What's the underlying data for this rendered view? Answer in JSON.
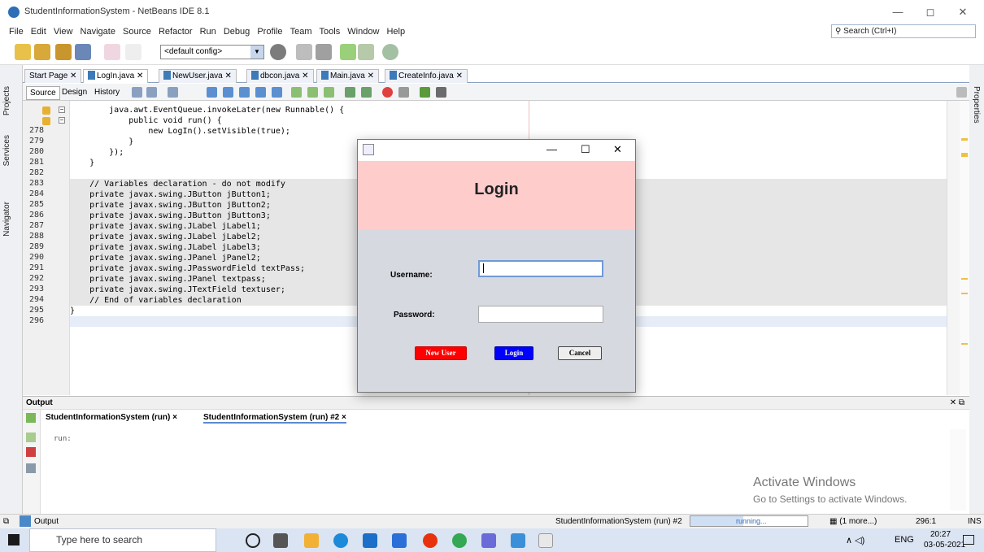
{
  "window": {
    "title": "StudentInformationSystem - NetBeans IDE 8.1",
    "minimize": "—",
    "maximize": "◻",
    "close": "✕"
  },
  "menu": [
    "File",
    "Edit",
    "View",
    "Navigate",
    "Source",
    "Refactor",
    "Run",
    "Debug",
    "Profile",
    "Team",
    "Tools",
    "Window",
    "Help"
  ],
  "search": {
    "placeholder": "Search (Ctrl+I)"
  },
  "toolbar": {
    "config": "<default config>"
  },
  "side_tabs": {
    "projects": "Projects",
    "services": "Services",
    "navigator": "Navigator",
    "properties": "Properties"
  },
  "file_tabs": [
    "Start Page",
    "LogIn.java",
    "NewUser.java",
    "dbcon.java",
    "Main.java",
    "CreateInfo.java"
  ],
  "editor_modes": {
    "source": "Source",
    "design": "Design",
    "history": "History"
  },
  "code_lines": [
    {
      "n": "",
      "t": "        java.awt.EventQueue.invokeLater(new Runnable() {"
    },
    {
      "n": "",
      "t": "            public void run() {"
    },
    {
      "n": "278",
      "t": "                new LogIn().setVisible(true);"
    },
    {
      "n": "279",
      "t": "            }"
    },
    {
      "n": "280",
      "t": "        });"
    },
    {
      "n": "281",
      "t": "    }"
    },
    {
      "n": "282",
      "t": ""
    },
    {
      "n": "283",
      "t": "    // Variables declaration - do not modify"
    },
    {
      "n": "284",
      "t": "    private javax.swing.JButton jButton1;"
    },
    {
      "n": "285",
      "t": "    private javax.swing.JButton jButton2;"
    },
    {
      "n": "286",
      "t": "    private javax.swing.JButton jButton3;"
    },
    {
      "n": "287",
      "t": "    private javax.swing.JLabel jLabel1;"
    },
    {
      "n": "288",
      "t": "    private javax.swing.JLabel jLabel2;"
    },
    {
      "n": "289",
      "t": "    private javax.swing.JLabel jLabel3;"
    },
    {
      "n": "290",
      "t": "    private javax.swing.JPanel jPanel2;"
    },
    {
      "n": "291",
      "t": "    private javax.swing.JPasswordField textPass;"
    },
    {
      "n": "292",
      "t": "    private javax.swing.JPanel textpass;"
    },
    {
      "n": "293",
      "t": "    private javax.swing.JTextField textuser;"
    },
    {
      "n": "294",
      "t": "    // End of variables declaration"
    },
    {
      "n": "295",
      "t": "}"
    },
    {
      "n": "296",
      "t": ""
    }
  ],
  "output": {
    "title": "Output",
    "tabs": [
      "StudentInformationSystem (run)",
      "StudentInformationSystem (run) #2"
    ],
    "text": "run:"
  },
  "watermark": {
    "line1": "Activate Windows",
    "line2": "Go to Settings to activate Windows."
  },
  "statusbar": {
    "output_tab": "Output",
    "task": "StudentInformationSystem (run) #2",
    "progress_label": "running...",
    "progress_fraction": 0.45,
    "more": "(1 more...)",
    "position": "296:1",
    "mode": "INS"
  },
  "taskbar": {
    "search_placeholder": "Type here to search",
    "lang": "ENG",
    "time": "20:27",
    "date": "03-05-2021"
  },
  "dialog": {
    "title": "Login",
    "username_label": "Username:",
    "password_label": "Password:",
    "username_value": "",
    "password_value": "",
    "btn_new_user": "New User",
    "btn_login": "Login",
    "btn_cancel": "Cancel"
  },
  "colors": {
    "dialog_header": "#ffcccc",
    "dialog_body": "#d6d9e0",
    "new_user_btn": "#ff0000",
    "login_btn": "#0000ff"
  }
}
